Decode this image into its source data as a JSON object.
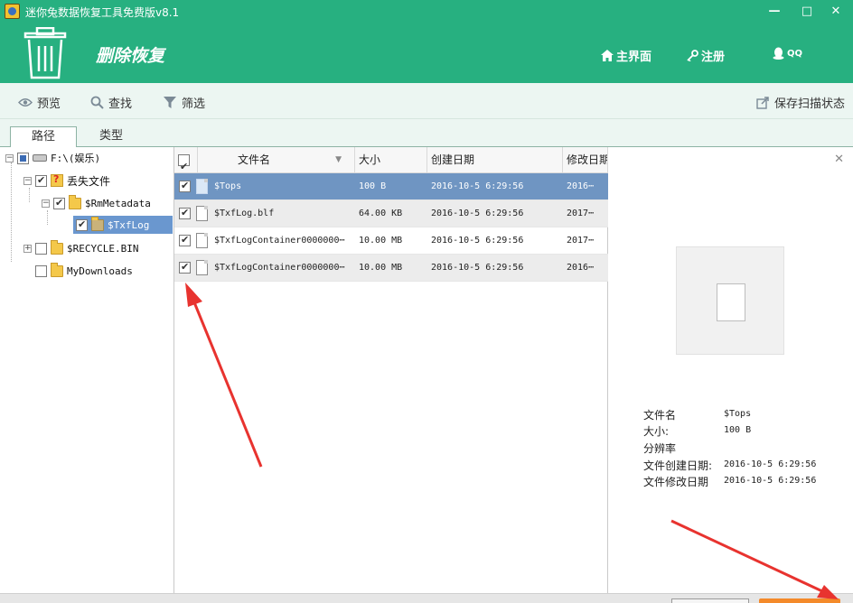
{
  "window": {
    "title": "迷你兔数据恢复工具免费版v8.1"
  },
  "header": {
    "page_title": "删除恢复",
    "nav": {
      "home": "主界面",
      "register": "注册",
      "qq": "QQ"
    }
  },
  "toolbar": {
    "preview": "预览",
    "find": "查找",
    "filter": "筛选",
    "save_scan": "保存扫描状态"
  },
  "tabs": {
    "path": "路径",
    "type": "类型"
  },
  "tree": {
    "drive": "F:\\(娱乐)",
    "lost_files": "丢失文件",
    "rm_metadata": "$RmMetadata",
    "txflog": "$TxfLog",
    "recycle_bin": "$RECYCLE.BIN",
    "my_downloads": "MyDownloads"
  },
  "table": {
    "headers": {
      "name": "文件名",
      "size": "大小",
      "created": "创建日期",
      "modified": "修改日期"
    },
    "rows": [
      {
        "name": "$Tops",
        "size": "100 B",
        "created": "2016-10-5 6:29:56",
        "modified": "2016⋯"
      },
      {
        "name": "$TxfLog.blf",
        "size": "64.00 KB",
        "created": "2016-10-5 6:29:56",
        "modified": "2017⋯"
      },
      {
        "name": "$TxfLogContainer0000000⋯",
        "size": "10.00 MB",
        "created": "2016-10-5 6:29:56",
        "modified": "2017⋯"
      },
      {
        "name": "$TxfLogContainer0000000⋯",
        "size": "10.00 MB",
        "created": "2016-10-5 6:29:56",
        "modified": "2016⋯"
      }
    ]
  },
  "preview": {
    "labels": {
      "name": "文件名",
      "size": "大小:",
      "resolution": "分辨率",
      "created": "文件创建日期:",
      "modified": "文件修改日期"
    },
    "values": {
      "name": "$Tops",
      "size": "100 B",
      "resolution": "",
      "created": "2016-10-5 6:29:56",
      "modified": "2016-10-5 6:29:56"
    }
  },
  "colors": {
    "header_bg": "#27b080",
    "selected_row": "#6f95c2",
    "arrow": "#e8332f",
    "recover_button": "#f48a2a"
  }
}
